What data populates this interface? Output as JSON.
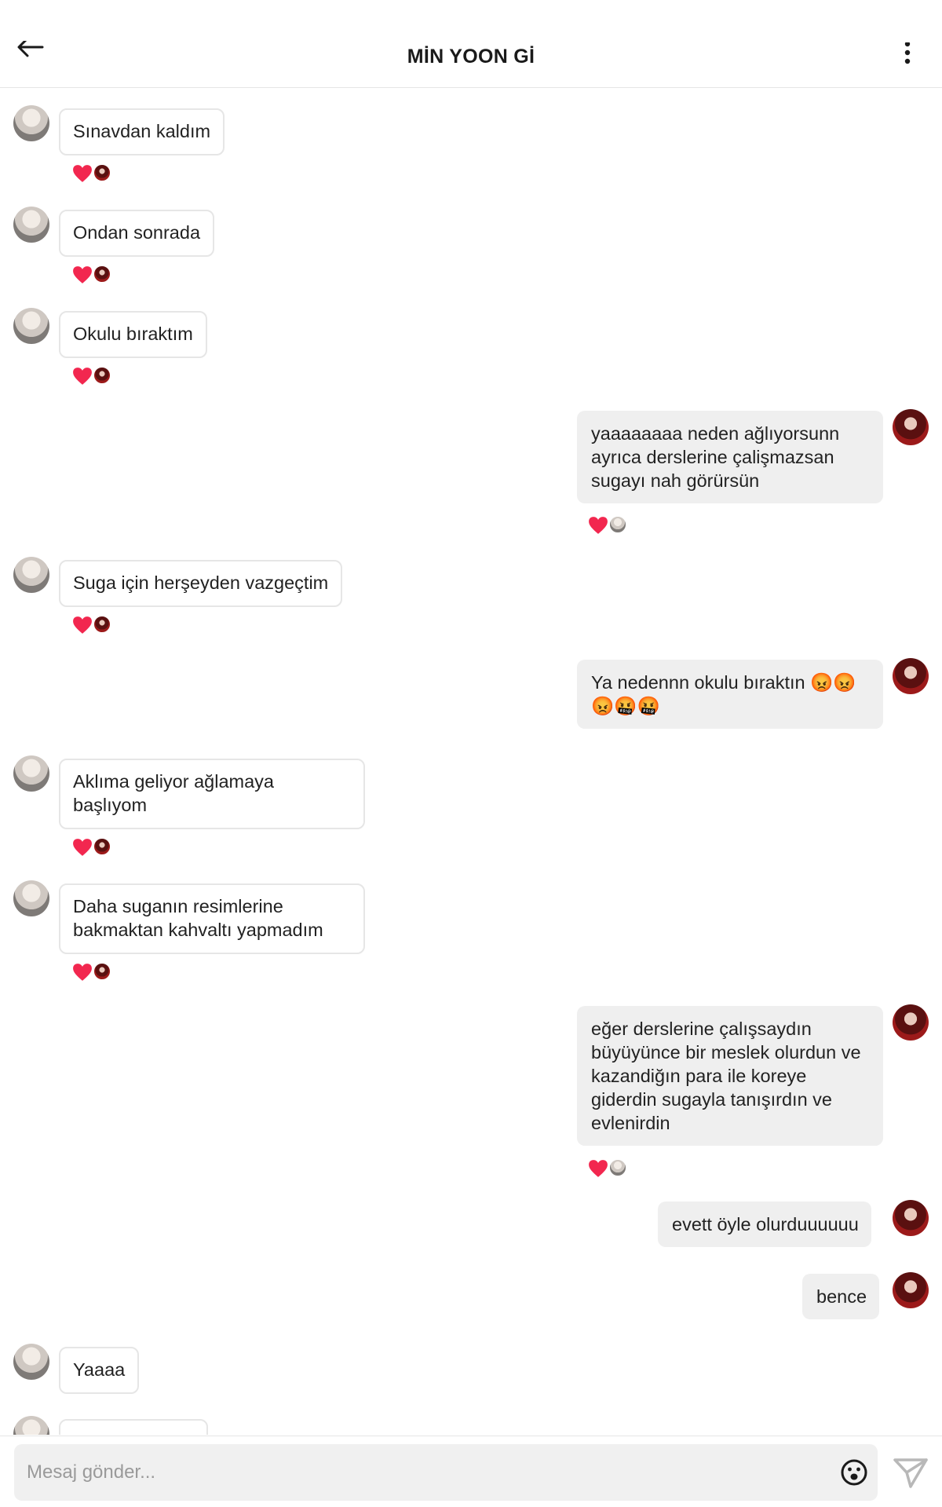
{
  "header": {
    "title": "MİN YOON Gİ",
    "back_icon": "arrow-left-icon",
    "more_icon": "vertical-ellipsis-icon"
  },
  "colors": {
    "heart": "#f2274f",
    "incoming_border": "#e6e6e6",
    "outgoing_bg": "#efefef",
    "input_bg": "#f0f0f0"
  },
  "messages": [
    {
      "side": "in",
      "text": "Sınavdan kaldım",
      "reaction": "heart"
    },
    {
      "side": "in",
      "text": "Ondan sonrada",
      "reaction": "heart"
    },
    {
      "side": "in",
      "text": "Okulu bıraktım",
      "reaction": "heart"
    },
    {
      "side": "out",
      "text": "yaaaaaaaa neden ağlıyorsunn ayrıca derslerine çalişmazsan sugayı nah görürsün",
      "reaction": "heart"
    },
    {
      "side": "in",
      "text": "Suga için herşeyden vazgeçtim",
      "reaction": "heart"
    },
    {
      "side": "out",
      "text": "Ya nedennn okulu bıraktın 😡😡 😡🤬🤬",
      "reaction": null
    },
    {
      "side": "in",
      "text": "Aklıma geliyor ağlamaya başlıyom",
      "reaction": "heart"
    },
    {
      "side": "in",
      "text": "Daha suganın resimlerine bakmaktan kahvaltı yapmadım",
      "reaction": "heart"
    },
    {
      "side": "out",
      "text": "eğer derslerine çalışsaydın büyüyünce bir meslek olurdun ve kazandiğın para ile koreye giderdin sugayla tanışırdın ve evlenirdin",
      "reaction": "heart"
    },
    {
      "side": "out",
      "text": "evett öyle olurduuuuuu",
      "reaction": null
    },
    {
      "side": "out",
      "text": "bence",
      "reaction": null
    },
    {
      "side": "in",
      "text": "Yaaaa",
      "reaction": null
    }
  ],
  "composer": {
    "placeholder": "Mesaj gönder...",
    "emoji_icon": "smiley-face-icon",
    "send_icon": "paper-plane-icon"
  }
}
